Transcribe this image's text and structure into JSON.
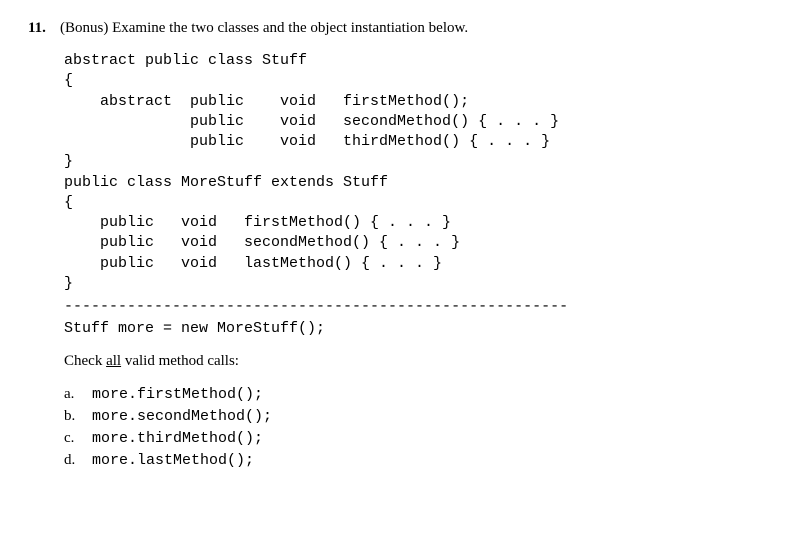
{
  "question": {
    "number": "11.",
    "tag": "(Bonus)",
    "prompt_rest": " Examine the two classes and the object instantiation below."
  },
  "code": {
    "class1_l1": "abstract public class Stuff",
    "class1_l2": "{",
    "class1_l3": "    abstract  public    void   firstMethod();",
    "class1_l4": "              public    void   secondMethod() { . . . }",
    "class1_l5": "              public    void   thirdMethod() { . . . }",
    "class1_l6": "}",
    "blank1": "",
    "class2_l1": "public class MoreStuff extends Stuff",
    "class2_l2": "{",
    "class2_l3": "    public   void   firstMethod() { . . . }",
    "class2_l4": "    public   void   secondMethod() { . . . }",
    "class2_l5": "    public   void   lastMethod() { . . . }",
    "class2_l6": "}",
    "instantiation": "Stuff more = new MoreStuff();"
  },
  "separator": "--------------------------------------------------------",
  "instruction": {
    "pre": "Check ",
    "underlined": "all",
    "post": " valid method calls:"
  },
  "options": [
    {
      "label": "a.",
      "code": "more.firstMethod();"
    },
    {
      "label": "b.",
      "code": "more.secondMethod();"
    },
    {
      "label": "c.",
      "code": "more.thirdMethod();"
    },
    {
      "label": "d.",
      "code": "more.lastMethod();"
    }
  ]
}
